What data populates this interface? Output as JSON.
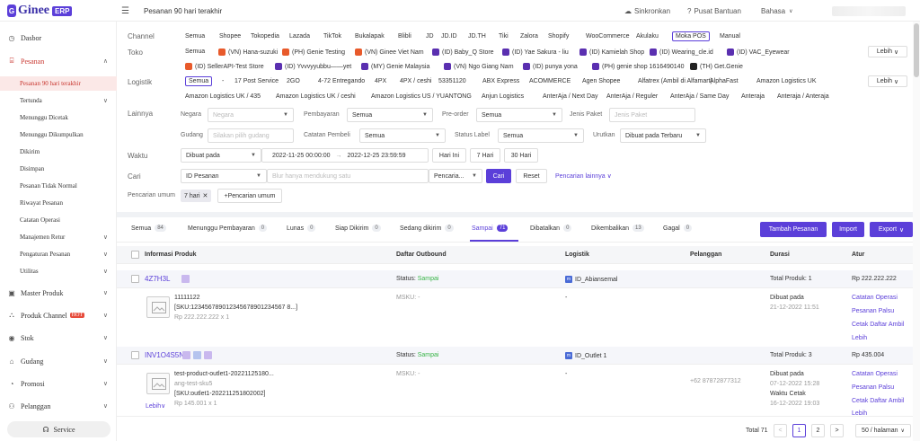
{
  "app": {
    "logo_letter": "G",
    "logo_text": "Ginee",
    "logo_badge": "ERP",
    "page_title": "Pesanan 90 hari terakhir",
    "sync": "Sinkronkan",
    "help": "Pusat Bantuan",
    "lang": "Bahasa"
  },
  "sidebar": {
    "items": [
      {
        "label": "Dasbor",
        "icon": "dashboard-icon",
        "glyph": "◷"
      },
      {
        "label": "Pesanan",
        "icon": "cart-icon",
        "glyph": "⌸"
      },
      {
        "label": "Master Produk",
        "icon": "box-icon",
        "glyph": "▣"
      },
      {
        "label": "Produk Channel",
        "icon": "channel-icon",
        "glyph": "⛬",
        "hot": "HOT"
      },
      {
        "label": "Stok",
        "icon": "stock-icon",
        "glyph": "◉"
      },
      {
        "label": "Gudang",
        "icon": "warehouse-icon",
        "glyph": "⌂"
      },
      {
        "label": "Promosi",
        "icon": "promo-icon",
        "glyph": "◔"
      },
      {
        "label": "Pelanggan",
        "icon": "customer-icon",
        "glyph": "⚇"
      }
    ],
    "sub": [
      "Pesanan 90 hari terakhir",
      "Tertunda",
      "Menunggu Dicetak",
      "Menunggu Dikumpulkan",
      "Dikirim",
      "Disimpan",
      "Pesanan Tidak Normal",
      "Riwayat Pesanan",
      "Catatan Operasi",
      "Manajemen Retur",
      "Pengaturan Pesanan",
      "Utilitas"
    ],
    "service": "Service"
  },
  "filters": {
    "channel_label": "Channel",
    "channels": [
      "Semua",
      "Shopee",
      "Tokopedia",
      "Lazada",
      "TikTok",
      "Bukalapak",
      "Blibli",
      "JD",
      "JD.ID",
      "JD.TH",
      "Tiki",
      "Zalora",
      "Shopify",
      "WooCommerce",
      "Akulaku",
      "Moka POS",
      "Manual"
    ],
    "toko_label": "Toko",
    "toko_row1": [
      "Semua",
      "(VN) Hana-suzuki",
      "(PH) Genie Testing",
      "(VN) Ginee Viet Nam",
      "(ID) Baby_Q Store",
      "(ID) Yae Sakura - liu",
      "(ID) Kamielah Shop",
      "(ID) Wearing_cle.id",
      "(ID) VAC_Eyewear"
    ],
    "toko_row2": [
      "(ID) SellerAPI-Test Store",
      "(ID) Yvvvyyubbu——yet",
      "(MY) Genie Malaysia",
      "(VN) Ngo Giang Nam",
      "(ID) punya yona",
      "(PH) genie shop 1616490140",
      "(TH) Get.Genie"
    ],
    "more": "Lebih",
    "logistik_label": "Logistik",
    "logi_row1": [
      "Semua",
      "-",
      "17 Post Service",
      "2GO",
      "4-72 Entregando",
      "4PX",
      "4PX / ceshi",
      "53351120",
      "ABX Express",
      "ACOMMERCE",
      "Agen Shopee",
      "Alfatrex (Ambil di Alfamart)",
      "AlphaFast",
      "Amazon Logistics UK"
    ],
    "logi_row2": [
      "Amazon Logistics UK / 435",
      "Amazon Logistics UK / ceshi",
      "Amazon Logistics US / YUANTONG",
      "Anjun Logistics",
      "AnterAja / Next Day",
      "AnterAja / Reguler",
      "AnterAja / Same Day",
      "Anteraja",
      "Anteraja / Anteraja"
    ],
    "lainnya_label": "Lainnya",
    "negara_label": "Negara",
    "negara_ph": "Negara",
    "pembayaran_label": "Pembayaran",
    "pembayaran_val": "Semua",
    "preorder_label": "Pre-order",
    "preorder_val": "Semua",
    "jenis_label": "Jenis Paket",
    "jenis_ph": "Jenis Paket",
    "gudang_label": "Gudang",
    "gudang_ph": "Silakan pilih gudang",
    "catatan_label": "Catatan Pembeli",
    "catatan_val": "Semua",
    "status_label": "Status Label",
    "status_val": "Semua",
    "urutkan_label": "Urutkan",
    "urutkan_val": "Dibuat pada Terbaru",
    "waktu_label": "Waktu",
    "waktu_type": "Dibuat pada",
    "date_from": "2022-11-25 00:00:00",
    "date_arrow": "→",
    "date_to": "2022-12-25 23:59:59",
    "today": "Hari Ini",
    "d7": "7 Hari",
    "d30": "30 Hari",
    "cari_label": "Cari",
    "cari_type": "ID Pesanan",
    "cari_ph": "Blur hanya mendukung satu",
    "cari_mode": "Pencaria...",
    "cari_btn": "Cari",
    "reset": "Reset",
    "more_search": "Pencarian lainnya",
    "umum_label": "Pencarian umum",
    "umum_tag": "7 hari",
    "umum_add": "+Pencarian umum"
  },
  "tabs": [
    {
      "label": "Semua",
      "count": "84"
    },
    {
      "label": "Menunggu Pembayaran",
      "count": "0"
    },
    {
      "label": "Lunas",
      "count": "0"
    },
    {
      "label": "Siap Dikirim",
      "count": "0"
    },
    {
      "label": "Sedang dikirim",
      "count": "0"
    },
    {
      "label": "Sampai",
      "count": "71"
    },
    {
      "label": "Dibatalkan",
      "count": "0"
    },
    {
      "label": "Dikembalikan",
      "count": "13"
    },
    {
      "label": "Gagal",
      "count": "0"
    }
  ],
  "actions": {
    "add": "Tambah Pesanan",
    "import": "Import",
    "export": "Export"
  },
  "table": {
    "headers": [
      "Informasi Produk",
      "Daftar Outbound",
      "Logistik",
      "Pelanggan",
      "Durasi",
      "Atur"
    ],
    "orders": [
      {
        "id": "4Z7H3L",
        "status_prefix": "Status:",
        "status": "Sampai",
        "logistics": "ID_Abiansemal",
        "total": "Total Produk: 1",
        "price": "Rp 222.222.222",
        "product_name": "11111122",
        "sku": "[SKU:123456789012345678901234567 8...]",
        "product_price": "Rp 222.222.222 x 1",
        "msku": "MSKU: -",
        "outbound": "-",
        "created_label": "Dibuat pada",
        "created": "21-12-2022 11:51",
        "customer": "",
        "ops": [
          "Catatan Operasi",
          "Pesanan Palsu",
          "Cetak Daftar Ambil",
          "Lebih"
        ]
      },
      {
        "id": "INV1O4S5N",
        "status_prefix": "Status:",
        "status": "Sampai",
        "logistics": "ID_Outlet 1",
        "total": "Total Produk: 3",
        "price": "Rp 435.004",
        "product_name": "test-product-outlet1-20221125180...",
        "variant": "ang-test-sku5",
        "sku": "[SKU:outlet1-202211251802002]",
        "product_price": "Rp 145.001 x 1",
        "msku": "MSKU: -",
        "outbound": "-",
        "more": "Lebih",
        "customer": "+62 87872877312",
        "created_label": "Dibuat pada",
        "created": "07-12-2022 15:28",
        "print_label": "Waktu Cetak",
        "printed": "16-12-2022 19:03",
        "ops": [
          "Catatan Operasi",
          "Pesanan Palsu",
          "Cetak Daftar Ambil",
          "Lebih"
        ]
      }
    ]
  },
  "pager": {
    "total": "Total 71",
    "page1": "1",
    "page2": "2",
    "size": "50 / halaman",
    "prev": "<",
    "next": ">"
  }
}
